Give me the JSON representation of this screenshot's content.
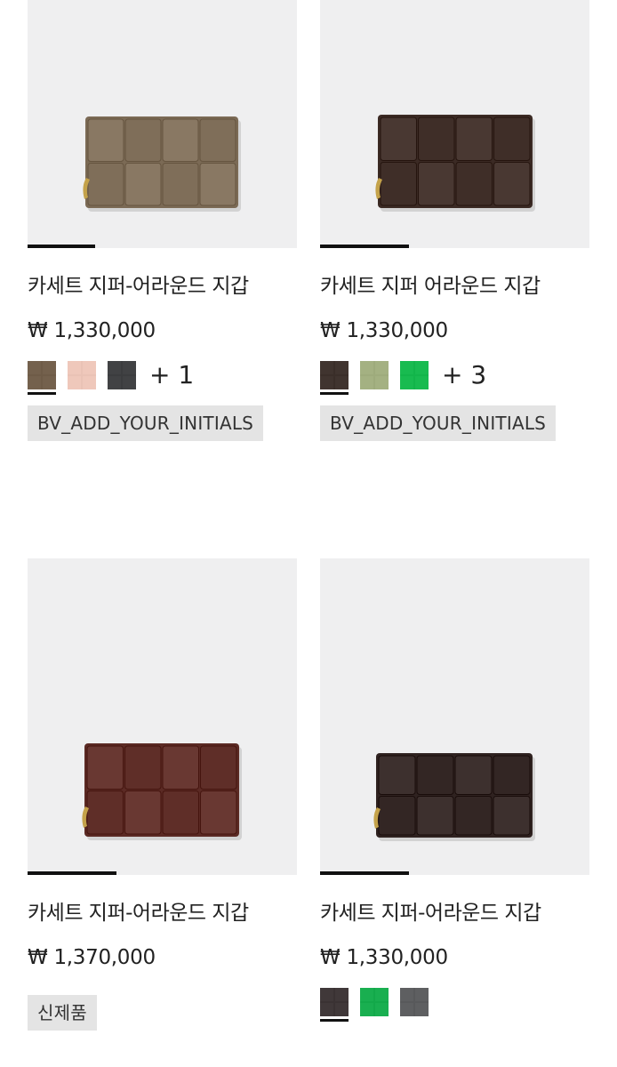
{
  "products": [
    {
      "title": "카세트 지퍼-어라운드 지갑",
      "price": "₩ 1,330,000",
      "image_icon": "brown-wallet-image",
      "wallet_color": "#7b6a55",
      "progress_fraction": 0.25,
      "swatches": [
        "#6e5b47",
        "#e9c2b5",
        "#3b3c3e"
      ],
      "more_label": "+ 1",
      "badge": "BV_ADD_YOUR_INITIALS"
    },
    {
      "title": "카세트 지퍼 어라운드 지갑",
      "price": "₩ 1,330,000",
      "image_icon": "dark-brown-wallet-image",
      "wallet_color": "#3b2a24",
      "progress_fraction": 0.33,
      "swatches": [
        "#3a2e29",
        "#9eab7c",
        "#12b54a"
      ],
      "more_label": "+ 3",
      "badge": "BV_ADD_YOUR_INITIALS"
    },
    {
      "title": "카세트 지퍼-어라운드 지갑",
      "price": "₩ 1,370,000",
      "image_icon": "burgundy-wallet-image",
      "wallet_color": "#5b2a24",
      "progress_fraction": 0.33,
      "swatches": [],
      "more_label": "",
      "badge": "신제품"
    },
    {
      "title": "카세트 지퍼-어라운드 지갑",
      "price": "₩ 1,330,000",
      "image_icon": "espresso-wallet-image",
      "wallet_color": "#2f2220",
      "progress_fraction": 0.33,
      "swatches": [
        "#3a3233",
        "#13a94a",
        "#58595b"
      ],
      "more_label": "",
      "badge": ""
    }
  ]
}
